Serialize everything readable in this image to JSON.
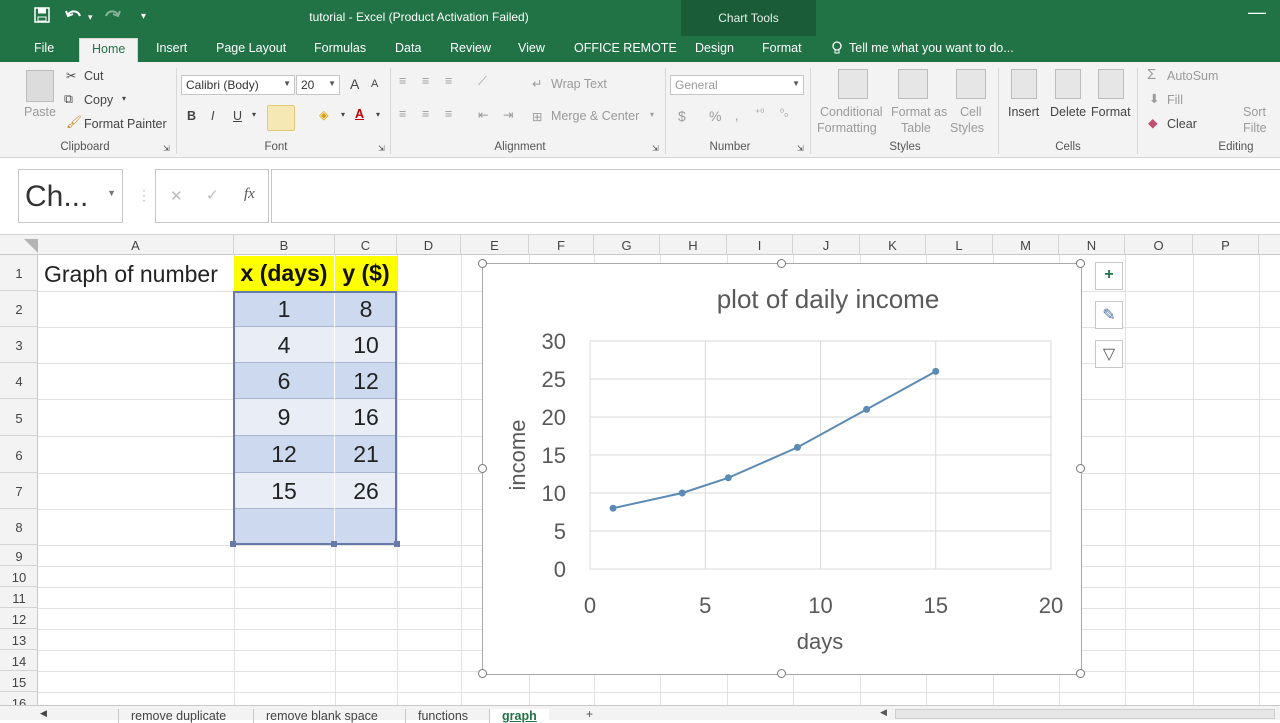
{
  "window": {
    "title": "tutorial - Excel (Product Activation Failed)",
    "context_tab_group": "Chart Tools",
    "minimize_glyph": "—",
    "qat_icons": [
      "save-icon",
      "undo-icon",
      "redo-icon",
      "customize-qat-icon"
    ]
  },
  "tabs": [
    {
      "label": "File"
    },
    {
      "label": "Home"
    },
    {
      "label": "Insert"
    },
    {
      "label": "Page Layout"
    },
    {
      "label": "Formulas"
    },
    {
      "label": "Data"
    },
    {
      "label": "Review"
    },
    {
      "label": "View"
    },
    {
      "label": "OFFICE REMOTE"
    },
    {
      "label": "Design"
    },
    {
      "label": "Format"
    }
  ],
  "tell_me": "Tell me what you want to do...",
  "ribbon": {
    "clipboard": {
      "paste": "Paste",
      "cut": "Cut",
      "copy": "Copy",
      "format_painter": "Format Painter",
      "label": "Clipboard"
    },
    "font": {
      "font_name": "Calibri (Body)",
      "font_size": "20",
      "grow": "A",
      "shrink": "A",
      "bold": "B",
      "italic": "I",
      "underline": "U",
      "color_letter": "A",
      "label": "Font"
    },
    "alignment": {
      "wrap_text": "Wrap Text",
      "merge_center": "Merge & Center",
      "label": "Alignment"
    },
    "number": {
      "format": "General",
      "currency": "$",
      "percent": "%",
      "label": "Number"
    },
    "styles": {
      "conditional": "Conditional",
      "formatting": "Formatting",
      "format_as": "Format as",
      "table": "Table",
      "cell": "Cell",
      "styles_word": "Styles",
      "label": "Styles"
    },
    "cells": {
      "insert": "Insert",
      "delete": "Delete",
      "format": "Format",
      "label": "Cells"
    },
    "editing": {
      "autosum": "AutoSum",
      "fill": "Fill",
      "clear": "Clear",
      "sort": "Sort",
      "filter": "Filte",
      "label": "Editing"
    }
  },
  "formula_bar": {
    "name_box": "Ch...",
    "fx": "fx",
    "cancel": "✕",
    "enter": "✓",
    "value": ""
  },
  "columns": [
    "A",
    "B",
    "C",
    "D",
    "E",
    "F",
    "G",
    "H",
    "I",
    "J",
    "K",
    "L",
    "M",
    "N",
    "O",
    "P"
  ],
  "rows": [
    "1",
    "2",
    "3",
    "4",
    "5",
    "6",
    "7",
    "8",
    "9",
    "10",
    "11",
    "12",
    "13",
    "14",
    "15",
    "16"
  ],
  "cells": {
    "a1": "Graph of number",
    "b1": "x (days)",
    "c1": "y ($)",
    "b_values": [
      "1",
      "4",
      "6",
      "9",
      "12",
      "15"
    ],
    "c_values": [
      "8",
      "10",
      "12",
      "16",
      "21",
      "26"
    ]
  },
  "chart_buttons": {
    "add": "+",
    "style": "✎",
    "filter": "▽"
  },
  "sheet_tabs": [
    {
      "label": "remove duplicate"
    },
    {
      "label": "remove blank space"
    },
    {
      "label": "functions"
    },
    {
      "label": "graph"
    }
  ],
  "sheet_add": "+",
  "colors": {
    "excel_green": "#217346",
    "header_yellow": "#ffff00",
    "selection_fill": "#cdd9ee",
    "series": "#5b8ab4"
  },
  "chart_data": {
    "type": "line",
    "title": "plot of daily income",
    "xlabel": "days",
    "ylabel": "income",
    "x": [
      1,
      4,
      6,
      9,
      12,
      15
    ],
    "series": [
      {
        "values": [
          8,
          10,
          12,
          16,
          21,
          26
        ]
      }
    ],
    "xlim": [
      0,
      20
    ],
    "ylim": [
      0,
      30
    ],
    "xticks": [
      0,
      5,
      10,
      15,
      20
    ],
    "yticks": [
      0,
      5,
      10,
      15,
      20,
      25,
      30
    ],
    "grid": true,
    "legend": "none"
  }
}
